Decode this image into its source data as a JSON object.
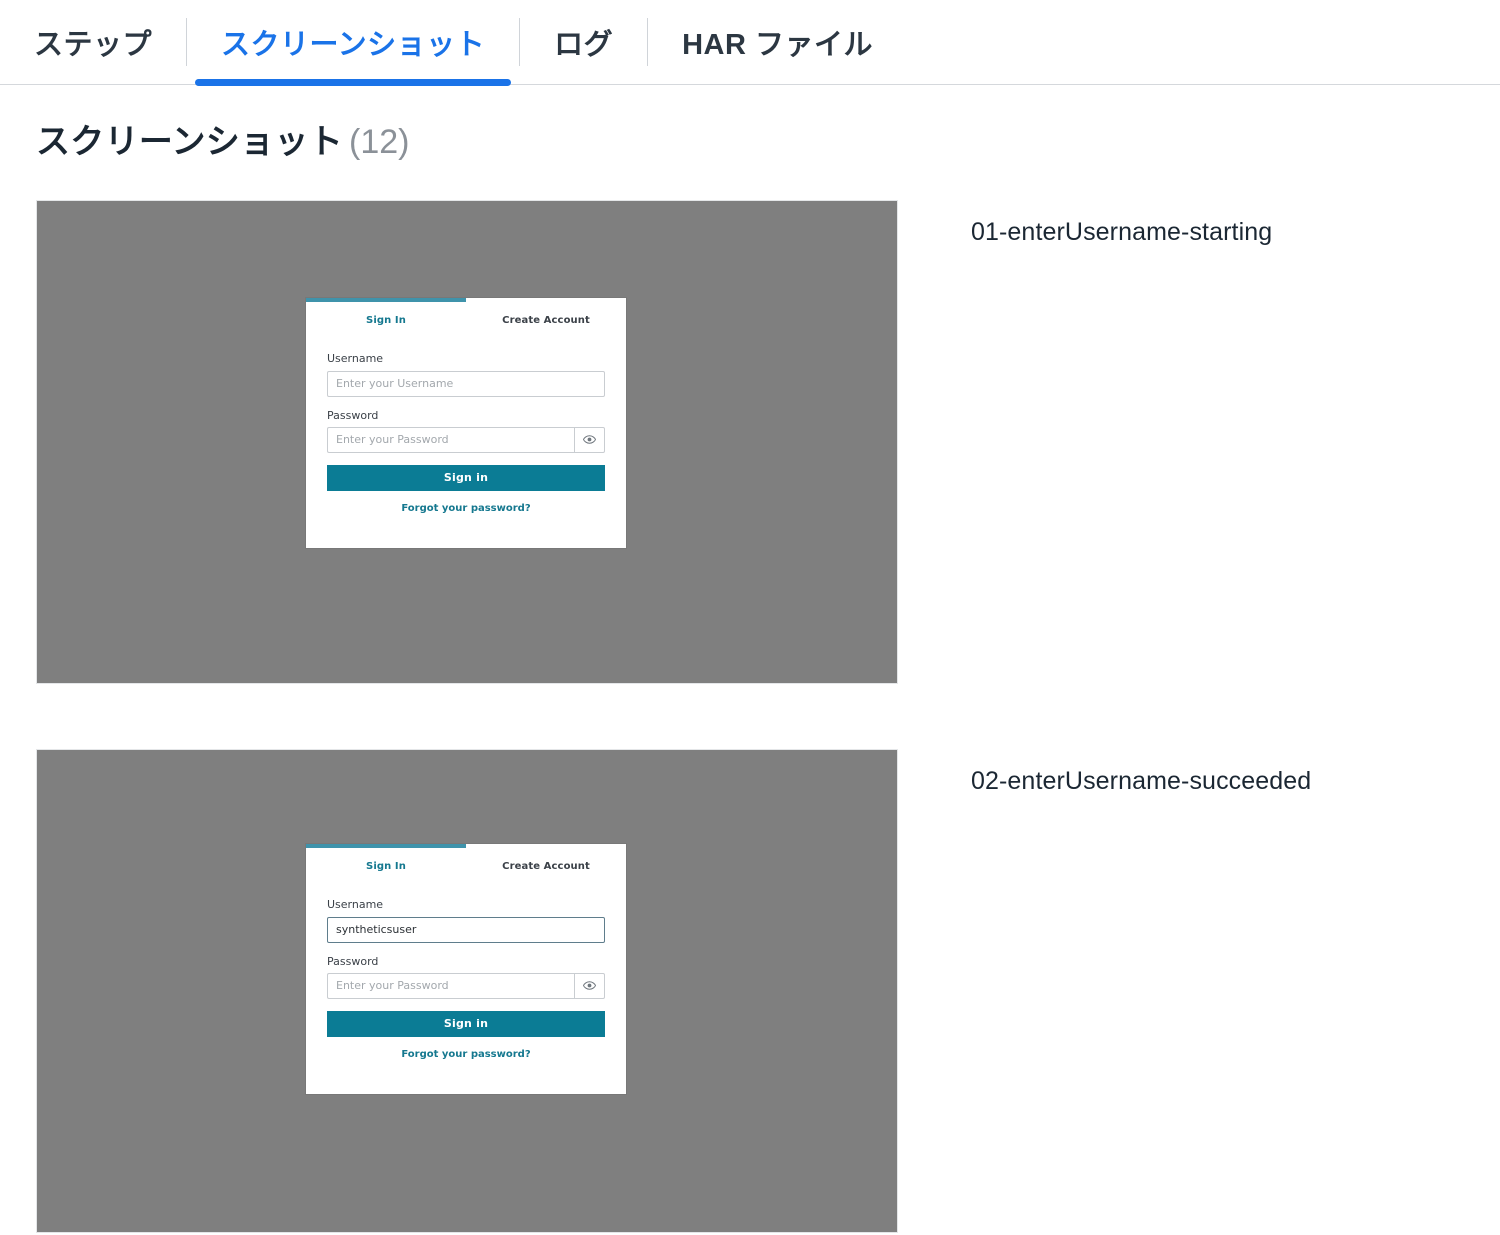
{
  "tabs": [
    {
      "label": "ステップ",
      "active": false
    },
    {
      "label": "スクリーンショット",
      "active": true
    },
    {
      "label": "ログ",
      "active": false
    },
    {
      "label": "HAR ファイル",
      "active": false
    }
  ],
  "page": {
    "heading": "スクリーンショット",
    "count": "(12)"
  },
  "colors": {
    "active_tab": "#1a73e8",
    "backdrop": "#7f7f7f",
    "card_accent": "#3f93ab",
    "signin_button": "#0b7c95",
    "link": "#15788f"
  },
  "screenshots": [
    {
      "caption": "01-enterUsername-starting",
      "form": {
        "tab_signin": "Sign In",
        "tab_create": "Create Account",
        "username_label": "Username",
        "username_placeholder": "Enter your Username",
        "username_value": "",
        "password_label": "Password",
        "password_placeholder": "Enter your Password",
        "password_value": "",
        "reveal_icon": "eye-icon",
        "submit_label": "Sign in",
        "forgot_label": "Forgot your password?"
      }
    },
    {
      "caption": "02-enterUsername-succeeded",
      "form": {
        "tab_signin": "Sign In",
        "tab_create": "Create Account",
        "username_label": "Username",
        "username_placeholder": "Enter your Username",
        "username_value": "syntheticsuser",
        "password_label": "Password",
        "password_placeholder": "Enter your Password",
        "password_value": "",
        "reveal_icon": "eye-icon",
        "submit_label": "Sign in",
        "forgot_label": "Forgot your password?"
      }
    }
  ]
}
